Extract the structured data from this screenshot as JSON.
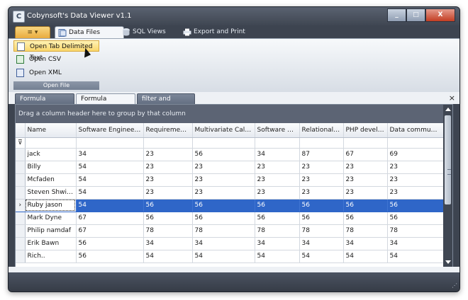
{
  "window": {
    "title": "Cobynsoft's Data Viewer v1.1",
    "app_icon_letter": "C",
    "controls": {
      "minimize": "_",
      "maximize": "□",
      "close": "X"
    }
  },
  "ribbon": {
    "app_menu_glyph": "≡ ▾",
    "tabs": [
      {
        "label": "Data Files",
        "icon": "data-files-icon",
        "active": true
      },
      {
        "label": "SQL Views",
        "icon": "database-icon",
        "active": false
      },
      {
        "label": "Export and Print",
        "icon": "printer-icon",
        "active": false
      }
    ],
    "group": {
      "label": "Open File",
      "items": [
        {
          "label": "Open Tab Delimited Text",
          "icon": "text-file-icon",
          "hover": true
        },
        {
          "label": "Open CSV",
          "icon": "csv-file-icon",
          "hover": false
        },
        {
          "label": "Open XML",
          "icon": "xml-file-icon",
          "hover": false
        }
      ]
    }
  },
  "document_tabs": [
    {
      "label": "Formula Marks.csv",
      "active": false
    },
    {
      "label": "Formula Marks.csv",
      "active": true
    },
    {
      "label": "filter and sort.xml",
      "active": false
    }
  ],
  "close_tab_glyph": "×",
  "grid": {
    "group_panel_text": "Drag a column header here to group by that column",
    "filter_glyph": "⊽",
    "current_row_glyph": "›",
    "columns": [
      "Name",
      "Software Engineering",
      "Requirement ...",
      "Multivariate Calculus",
      "Software A...",
      "Relational D...",
      "PHP develo...",
      "Data communi..."
    ],
    "rows": [
      [
        "jack",
        "34",
        "23",
        "56",
        "34",
        "87",
        "67",
        "69"
      ],
      [
        "Billy",
        "54",
        "23",
        "23",
        "23",
        "23",
        "23",
        "23"
      ],
      [
        "Mcfaden",
        "54",
        "23",
        "23",
        "23",
        "23",
        "23",
        "23"
      ],
      [
        "Steven Shwim...",
        "54",
        "23",
        "23",
        "23",
        "23",
        "23",
        "23"
      ],
      [
        "Ruby jason",
        "54",
        "56",
        "56",
        "56",
        "56",
        "56",
        "56"
      ],
      [
        "Mark Dyne",
        "67",
        "56",
        "56",
        "56",
        "56",
        "56",
        "56"
      ],
      [
        "Philip namdaf",
        "67",
        "78",
        "78",
        "78",
        "78",
        "78",
        "78"
      ],
      [
        "Erik Bawn",
        "56",
        "34",
        "34",
        "34",
        "34",
        "34",
        "34"
      ],
      [
        "Rich..",
        "56",
        "54",
        "54",
        "54",
        "54",
        "54",
        "54"
      ]
    ],
    "selected_row": 4
  },
  "status": {
    "grip": "⋰"
  },
  "colors": {
    "chrome": "#3d4450",
    "selection": "#2f66c8",
    "app_button": "#f0bf58",
    "hover_item": "#f9d66c"
  }
}
